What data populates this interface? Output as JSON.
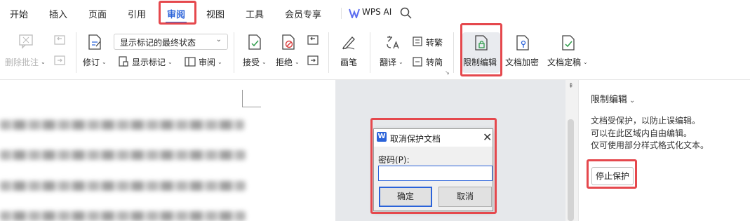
{
  "menu": {
    "items": [
      "开始",
      "插入",
      "页面",
      "引用",
      "审阅",
      "视图",
      "工具",
      "会员专享"
    ],
    "active": "审阅",
    "wps_ai": "WPS AI"
  },
  "ribbon": {
    "delete_comment": "删除批注",
    "revise": "修订",
    "markup_dropdown": "显示标记的最终状态",
    "show_markup": "显示标记",
    "review": "审阅",
    "accept": "接受",
    "reject": "拒绝",
    "pen": "画笔",
    "translate": "翻译",
    "to_traditional": "转繁",
    "to_simplified": "转简",
    "restrict_edit": "限制编辑",
    "doc_encrypt": "文档加密",
    "doc_finalize": "文档定稿"
  },
  "panel": {
    "title": "限制编辑",
    "line1": "文档受保护，以防止误编辑。",
    "line2": "可以在此区域内自由编辑。",
    "line3": "仅可使用部分样式格式化文本。",
    "stop_button": "停止保护"
  },
  "dialog": {
    "logo": "W",
    "title": "取消保护文档",
    "password_label": "密码(P):",
    "password_value": "",
    "ok": "确定",
    "cancel": "取消"
  },
  "colors": {
    "accent": "#2b63d9",
    "highlight": "#e5484d"
  }
}
